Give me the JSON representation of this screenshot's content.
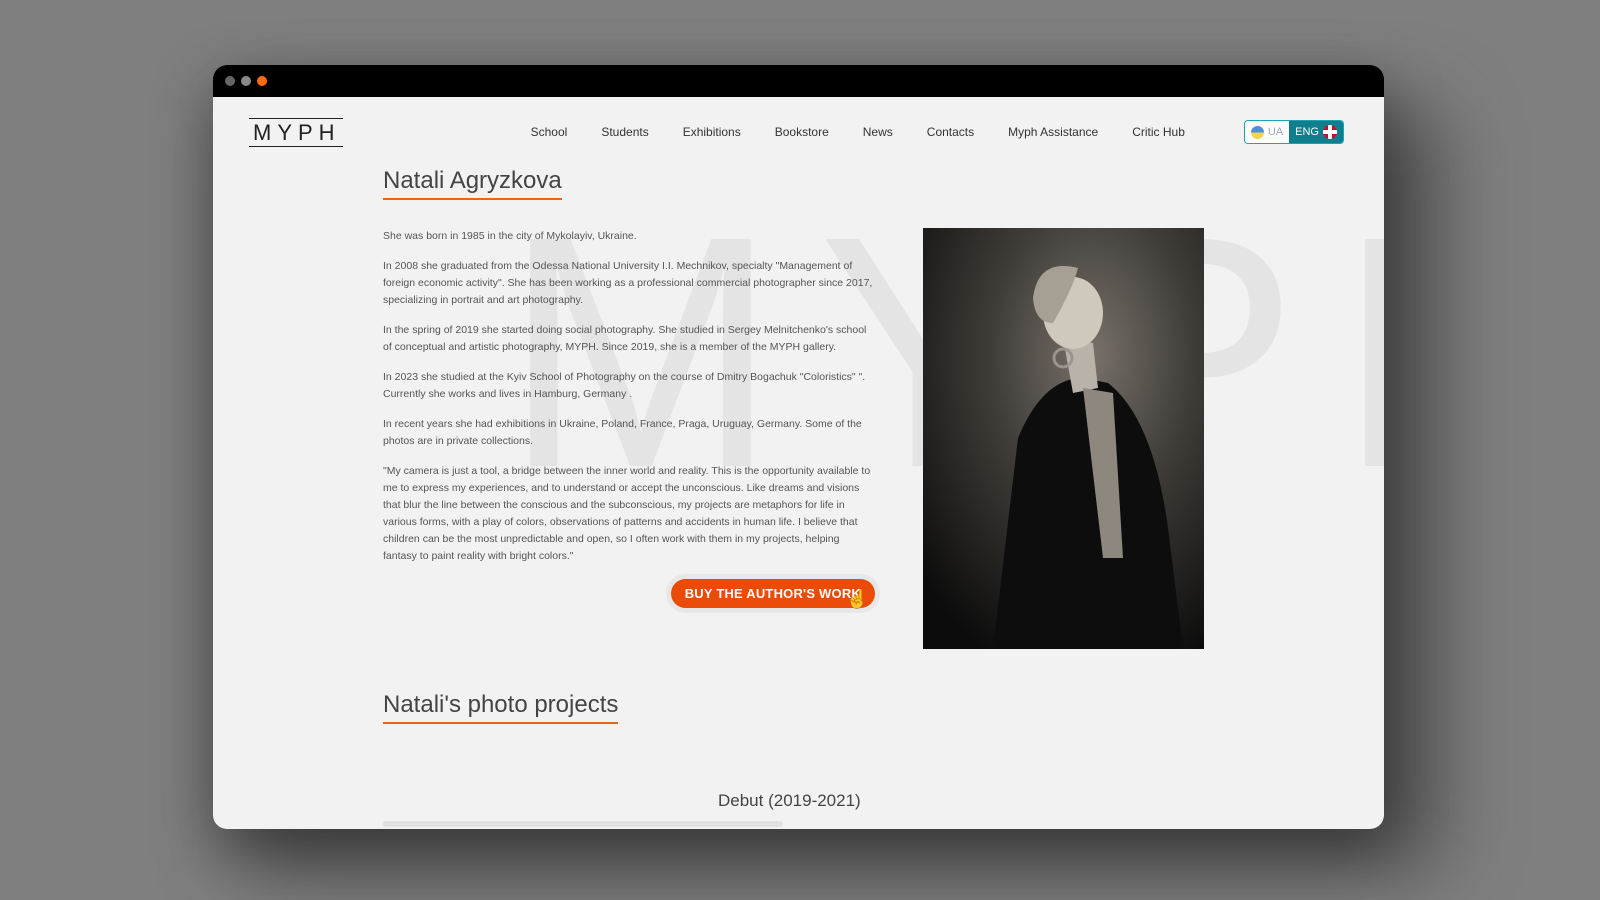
{
  "window": {
    "dots": [
      "gray",
      "gray",
      "orange"
    ]
  },
  "header": {
    "logo": "MYPH",
    "nav": [
      "School",
      "Students",
      "Exhibitions",
      "Bookstore",
      "News",
      "Contacts",
      "Myph Assistance",
      "Critic Hub"
    ],
    "lang": {
      "ua": "UA",
      "eng": "ENG",
      "active": "ENG"
    }
  },
  "watermark": "MYPH",
  "author": {
    "name": "Natali Agryzkova",
    "bio": [
      "She was born in 1985 in the city of Mykolayiv, Ukraine.",
      "In 2008 she graduated from the Odessa National University I.I. Mechnikov, specialty \"Management of foreign economic activity\". She has been working as a professional commercial photographer since 2017, specializing in portrait and art photography.",
      "In the spring of 2019 she started doing social photography. She studied in Sergey Melnitchenko's school of conceptual and artistic photography, MYPH. Since 2019, she is a member of the MYPH gallery.",
      "In 2023 she studied at the Kyiv School of Photography on the course of Dmitry Bogachuk \"Coloristics\" \". Currently she works and lives in Hamburg, Germany .",
      "In recent years she had exhibitions in Ukraine, Poland, France, Praga, Uruguay, Germany. Some of the photos are in private collections.",
      "\"My camera is just a tool, a bridge between the inner world and reality. This is the opportunity available to me to express my experiences, and to understand or accept the unconscious. Like dreams and visions that blur the line between the conscious and the subconscious, my projects are metaphors for life in various forms, with a play of colors, observations of patterns and accidents in human life. I believe that children can be the most unpredictable and open, so I often work with them in my projects, helping fantasy to paint reality with bright colors.\""
    ],
    "buy_label": "BUY THE AUTHOR'S WORK",
    "photo_alt": "portrait-photo"
  },
  "projects": {
    "heading": "Natali's photo projects",
    "first_title": "Debut (2019-2021)"
  },
  "colors": {
    "accent": "#e8661c",
    "button": "#ea4b06",
    "lang_active": "#0f7f8d"
  }
}
